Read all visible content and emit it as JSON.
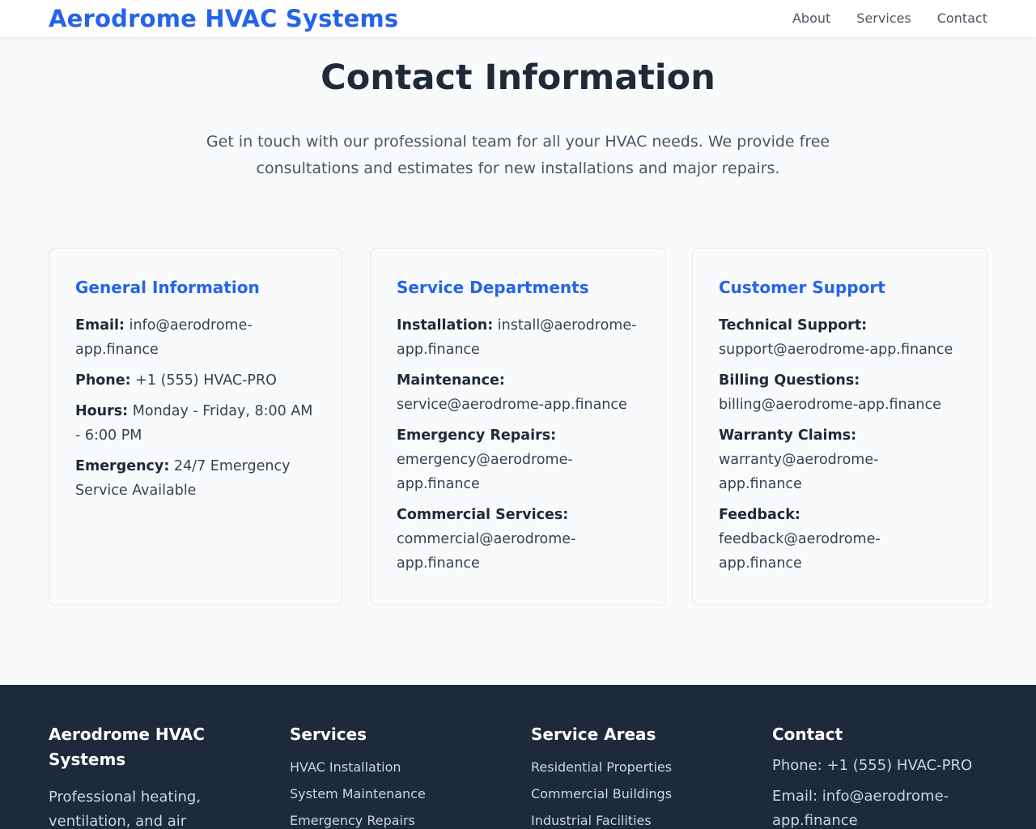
{
  "header": {
    "brand": "Aerodrome HVAC Systems",
    "nav": [
      "About",
      "Services",
      "Contact"
    ]
  },
  "main": {
    "title": "Contact Information",
    "intro": "Get in touch with our professional team for all your HVAC needs. We provide free consultations and estimates for new installations and major repairs.",
    "cards": [
      {
        "title": "General Information",
        "rows": [
          {
            "label": "Email:",
            "value": "info@aerodrome-app.finance"
          },
          {
            "label": "Phone:",
            "value": "+1 (555) HVAC-PRO"
          },
          {
            "label": "Hours:",
            "value": "Monday - Friday, 8:00 AM - 6:00 PM"
          },
          {
            "label": "Emergency:",
            "value": "24/7 Emergency Service Available"
          }
        ]
      },
      {
        "title": "Service Departments",
        "rows": [
          {
            "label": "Installation:",
            "value": "install@aerodrome-app.finance"
          },
          {
            "label": "Maintenance:",
            "value": "service@aerodrome-app.finance"
          },
          {
            "label": "Emergency Repairs:",
            "value": "emergency@aerodrome-app.finance"
          },
          {
            "label": "Commercial Services:",
            "value": "commercial@aerodrome-app.finance"
          }
        ]
      },
      {
        "title": "Customer Support",
        "rows": [
          {
            "label": "Technical Support:",
            "value": "support@aerodrome-app.finance"
          },
          {
            "label": "Billing Questions:",
            "value": "billing@aerodrome-app.finance"
          },
          {
            "label": "Warranty Claims:",
            "value": "warranty@aerodrome-app.finance"
          },
          {
            "label": "Feedback:",
            "value": "feedback@aerodrome-app.finance"
          }
        ]
      }
    ]
  },
  "footer": {
    "about": {
      "title": "Aerodrome HVAC Systems",
      "desc": "Professional heating, ventilation, and air"
    },
    "services": {
      "title": "Services",
      "items": [
        "HVAC Installation",
        "System Maintenance",
        "Emergency Repairs"
      ]
    },
    "areas": {
      "title": "Service Areas",
      "items": [
        "Residential Properties",
        "Commercial Buildings",
        "Industrial Facilities"
      ]
    },
    "contact": {
      "title": "Contact",
      "phone": "Phone: +1 (555) HVAC-PRO",
      "email": "Email: info@aerodrome-app.finance"
    }
  }
}
